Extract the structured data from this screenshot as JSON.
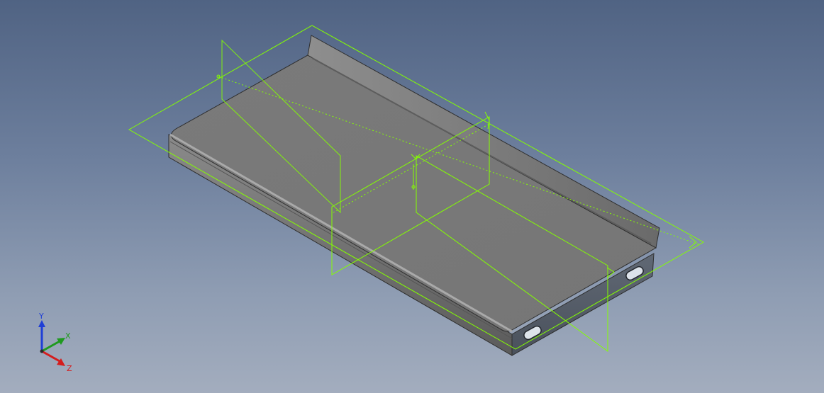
{
  "viewport": {
    "background_top": "#506383",
    "background_bottom": "#a3adbe"
  },
  "model": {
    "part_color": "#7d7d7d",
    "edge_color": "#2e2e2e",
    "wireframe_color": "#84ff00"
  },
  "triad": {
    "x_label": "X",
    "y_label": "Y",
    "z_label": "Z",
    "x_color": "#1f9a1f",
    "y_color": "#1f3fd6",
    "z_color": "#d41d1d"
  }
}
